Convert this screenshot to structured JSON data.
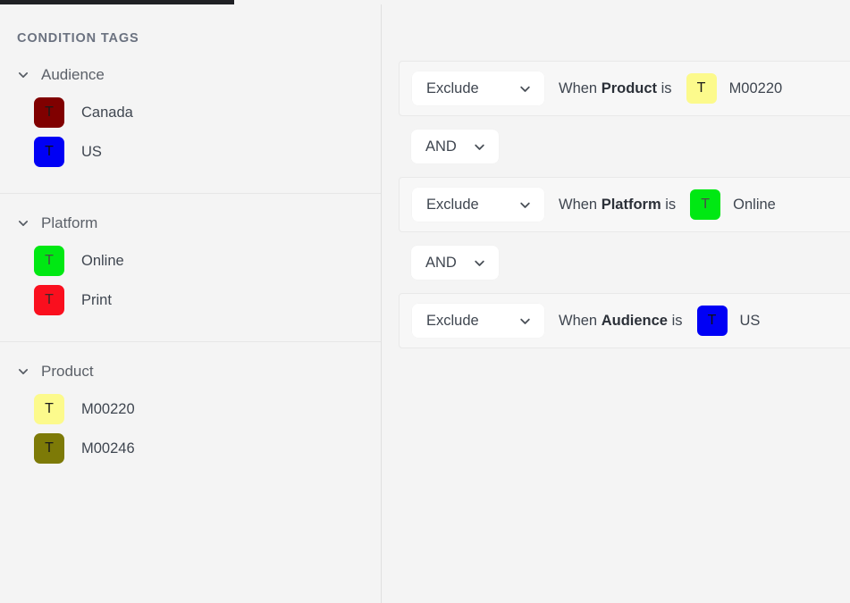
{
  "window": {
    "top_strip_color": "#1f2024",
    "background": "#f4f4f4"
  },
  "sidebar": {
    "title": "CONDITION TAGS",
    "groups": [
      {
        "label": "Audience",
        "expanded": true,
        "chevron_icon": "chevron-down-icon",
        "tags": [
          {
            "label": "Canada",
            "chip_letter": "T",
            "color": "#800000",
            "text_color": "#1a1a1a"
          },
          {
            "label": "US",
            "chip_letter": "T",
            "color": "#0000f5",
            "text_color": "#101010"
          }
        ]
      },
      {
        "label": "Platform",
        "expanded": true,
        "chevron_icon": "chevron-down-icon",
        "tags": [
          {
            "label": "Online",
            "chip_letter": "T",
            "color": "#00e813",
            "text_color": "#4a4a4a"
          },
          {
            "label": "Print",
            "chip_letter": "T",
            "color": "#fa0f1e",
            "text_color": "#3a2a2a"
          }
        ]
      },
      {
        "label": "Product",
        "expanded": true,
        "chevron_icon": "chevron-down-icon",
        "tags": [
          {
            "label": "M00220",
            "chip_letter": "T",
            "color": "#fcfa8c",
            "text_color": "#1a1a1a"
          },
          {
            "label": "M00246",
            "chip_letter": "T",
            "color": "#7d7a07",
            "text_color": "#1a1a1a"
          }
        ]
      }
    ]
  },
  "panel": {
    "rows": [
      {
        "kind": "condition",
        "action": "Exclude",
        "prefix": "When",
        "field": "Product",
        "suffix": "is",
        "tag": {
          "label": "M00220",
          "chip_letter": "T",
          "color": "#fcfa8c",
          "text_color": "#1a1a1a"
        }
      },
      {
        "kind": "operator",
        "operator": "AND"
      },
      {
        "kind": "condition",
        "action": "Exclude",
        "prefix": "When",
        "field": "Platform",
        "suffix": "is",
        "tag": {
          "label": "Online",
          "chip_letter": "T",
          "color": "#00e813",
          "text_color": "#4a4a4a"
        }
      },
      {
        "kind": "operator",
        "operator": "AND"
      },
      {
        "kind": "condition",
        "action": "Exclude",
        "prefix": "When",
        "field": "Audience",
        "suffix": "is",
        "tag": {
          "label": "US",
          "chip_letter": "T",
          "color": "#0000f5",
          "text_color": "#101010"
        }
      }
    ]
  }
}
